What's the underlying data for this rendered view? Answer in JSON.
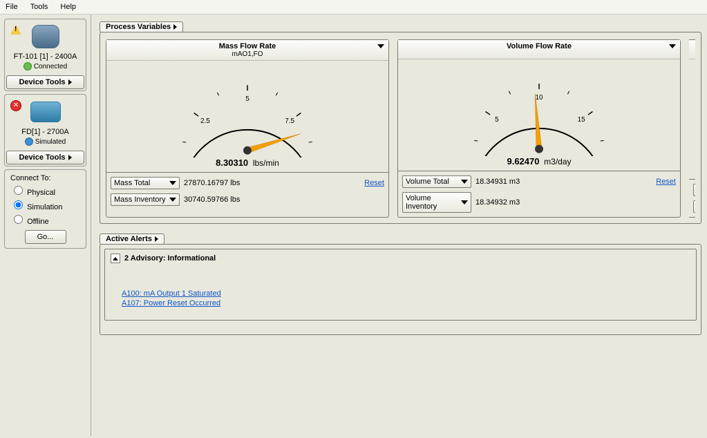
{
  "menu": {
    "file": "File",
    "tools": "Tools",
    "help": "Help"
  },
  "sidebar": {
    "devices": [
      {
        "name": "FT-101  [1] - 2400A",
        "status_text": "Connected",
        "status_kind": "ok",
        "tool_label": "Device Tools",
        "icon": "dev-img1",
        "badge": "warn"
      },
      {
        "name": "FD[1] - 2700A",
        "status_text": "Simulated",
        "status_kind": "sim",
        "tool_label": "Device Tools",
        "icon": "dev-img2",
        "badge": "err"
      }
    ],
    "connect": {
      "title": "Connect To:",
      "options": [
        "Physical",
        "Simulation",
        "Offline"
      ],
      "selected": "Simulation",
      "go": "Go..."
    }
  },
  "sections": {
    "process_vars": "Process Variables",
    "active_alerts": "Active Alerts"
  },
  "gauges": [
    {
      "title": "Mass Flow Rate",
      "subtitle": "mAO1,FO",
      "min": 0,
      "max": 10,
      "ticks": [
        "0",
        "2.5",
        "5",
        "7.5",
        "10"
      ],
      "value": 8.3031,
      "value_display": "8.30310",
      "unit": "lbs/min",
      "needle_color": "#f59f00",
      "totals": [
        {
          "label": "Mass Total",
          "value": "27870.16797 lbs"
        },
        {
          "label": "Mass Inventory",
          "value": "30740.59766 lbs"
        }
      ],
      "reset": "Reset"
    },
    {
      "title": "Volume Flow Rate",
      "subtitle": "",
      "min": 0,
      "max": 20,
      "ticks": [
        "0",
        "5",
        "10",
        "15",
        "20"
      ],
      "value": 9.6247,
      "value_display": "9.62470",
      "unit": "m3/day",
      "needle_color": "#f59f00",
      "totals": [
        {
          "label": "Volume Total",
          "value": "18.34931 m3"
        },
        {
          "label": "Volume Inventory",
          "value": "18.34932 m3"
        }
      ],
      "reset": "Reset"
    }
  ],
  "alerts": {
    "header": "2 Advisory: Informational",
    "items": [
      "A100: mA Output 1 Saturated",
      "A107: Power Reset Occurred"
    ]
  },
  "chart_data": [
    {
      "type": "gauge",
      "title": "Mass Flow Rate",
      "min": 0,
      "max": 10,
      "value": 8.3031,
      "unit": "lbs/min",
      "ticks": [
        0,
        2.5,
        5,
        7.5,
        10
      ]
    },
    {
      "type": "gauge",
      "title": "Volume Flow Rate",
      "min": 0,
      "max": 20,
      "value": 9.6247,
      "unit": "m3/day",
      "ticks": [
        0,
        5,
        10,
        15,
        20
      ]
    }
  ]
}
